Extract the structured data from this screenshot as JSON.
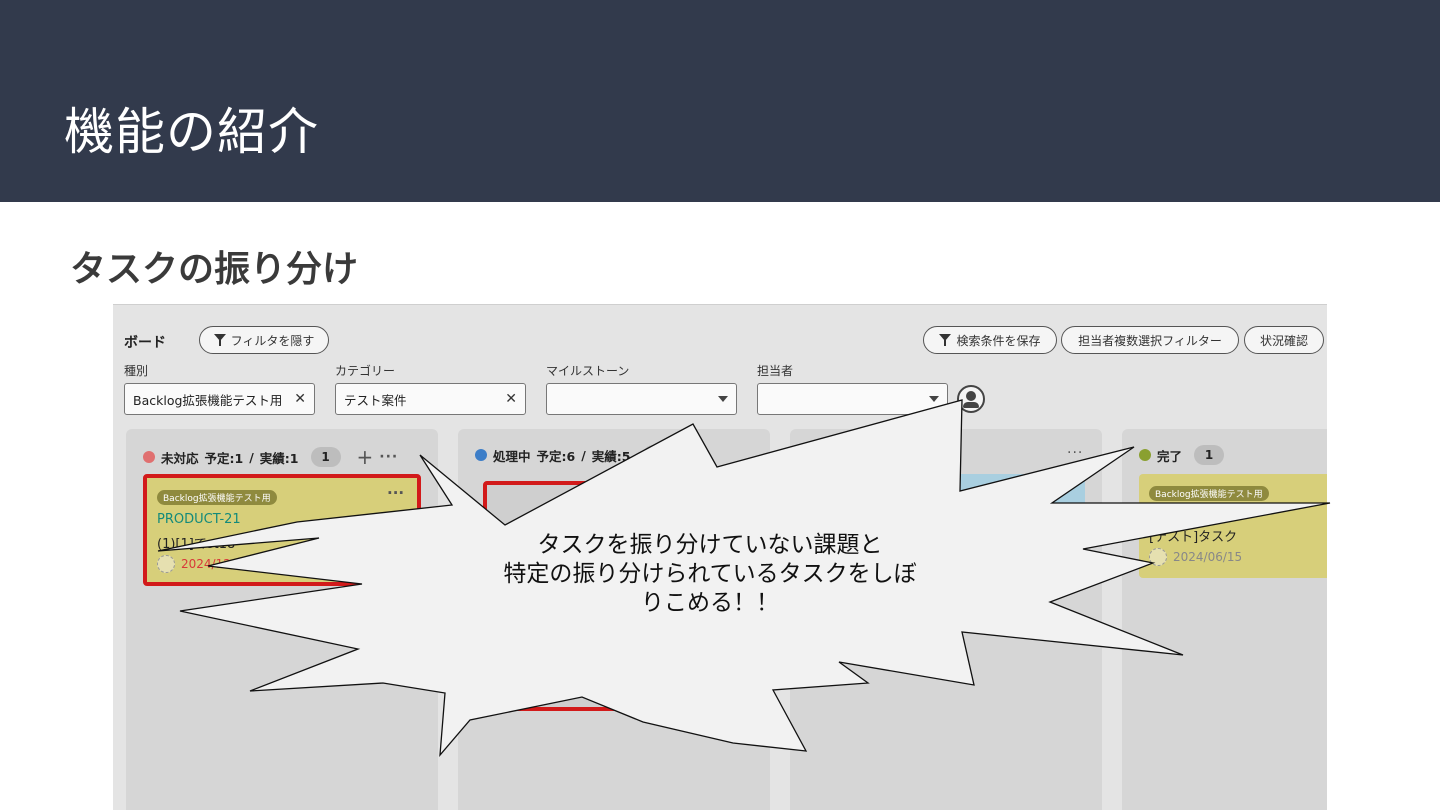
{
  "slide": {
    "title": "機能の紹介",
    "section": "タスクの振り分け"
  },
  "board": {
    "title": "ボード",
    "hide_filter_label": "フィルタを隠す",
    "save_search_label": "検索条件を保存",
    "multi_assignee_label": "担当者複数選択フィルター",
    "status_check_label": "状況確認"
  },
  "filters": {
    "type": {
      "label": "種別",
      "value": "Backlog拡張機能テスト用"
    },
    "category": {
      "label": "カテゴリー",
      "value": "テスト案件"
    },
    "milestone": {
      "label": "マイルストーン",
      "value": ""
    },
    "assignee": {
      "label": "担当者",
      "value": ""
    }
  },
  "columns": [
    {
      "name": "未対応",
      "plan": "予定:1",
      "sep": "/",
      "actual": "実績:1",
      "count": "1",
      "color": "#e07070"
    },
    {
      "name": "処理中",
      "plan": "予定:6",
      "sep": "/",
      "actual": "実績:5",
      "count": "",
      "color": "#3d7ec8"
    },
    {
      "name": "",
      "plan": "",
      "sep": "",
      "actual": "",
      "count": "",
      "color": "#4aaaa0"
    },
    {
      "name": "完了",
      "plan": "",
      "sep": "",
      "actual": "",
      "count": "1",
      "color": "#8aa030"
    }
  ],
  "cards": [
    {
      "tag": "Backlog拡張機能テスト用",
      "key": "PRODUCT-21",
      "summary": "(1)[1]てst18",
      "date": "2024/12/25",
      "date_color": "#d83a3a",
      "highlighted": true
    },
    {
      "tag": "Backlog拡張機能テスト用",
      "key": "",
      "summary": "[テスト]タスク",
      "date": "2024/06/15",
      "date_color": "#888888",
      "highlighted": false
    }
  ],
  "callout": {
    "line1": "タスクを振り分けていない課題と",
    "line2": "特定の振り分けられているタスクをしぼ",
    "line3": "りこめる！！"
  }
}
